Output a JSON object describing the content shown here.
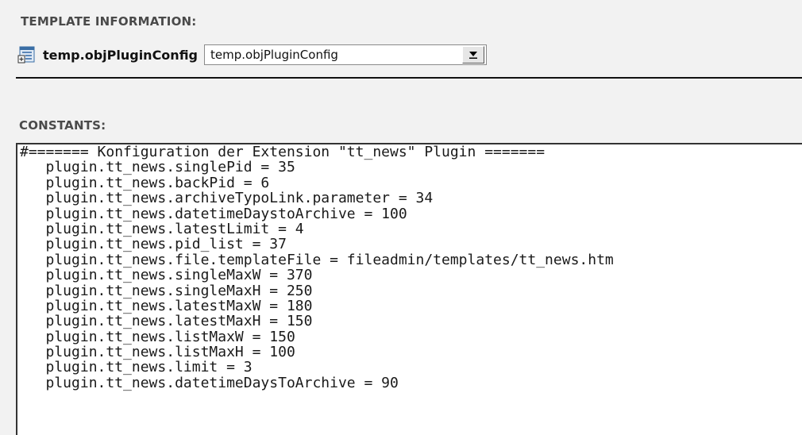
{
  "template_info": {
    "heading": "TEMPLATE INFORMATION:",
    "template_name": "temp.objPluginConfig",
    "select_value": "temp.objPluginConfig"
  },
  "constants": {
    "heading": "CONSTANTS:",
    "lines": [
      "#======= Konfiguration der Extension \"tt_news\" Plugin =======",
      "   plugin.tt_news.singlePid = 35",
      "   plugin.tt_news.backPid = 6",
      "   plugin.tt_news.archiveTypoLink.parameter = 34",
      "   plugin.tt_news.datetimeDaystoArchive = 100",
      "   plugin.tt_news.latestLimit = 4",
      "   plugin.tt_news.pid_list = 37",
      "   plugin.tt_news.file.templateFile = fileadmin/templates/tt_news.htm",
      "   plugin.tt_news.singleMaxW = 370",
      "   plugin.tt_news.singleMaxH = 250",
      "   plugin.tt_news.latestMaxW = 180",
      "   plugin.tt_news.latestMaxH = 150",
      "   plugin.tt_news.listMaxW = 150",
      "   plugin.tt_news.listMaxH = 100",
      "   plugin.tt_news.limit = 3",
      "   plugin.tt_news.datetimeDaysToArchive = 90"
    ]
  },
  "icons": {
    "template": "template-record-icon",
    "dropdown": "dropdown-arrow-icon"
  }
}
